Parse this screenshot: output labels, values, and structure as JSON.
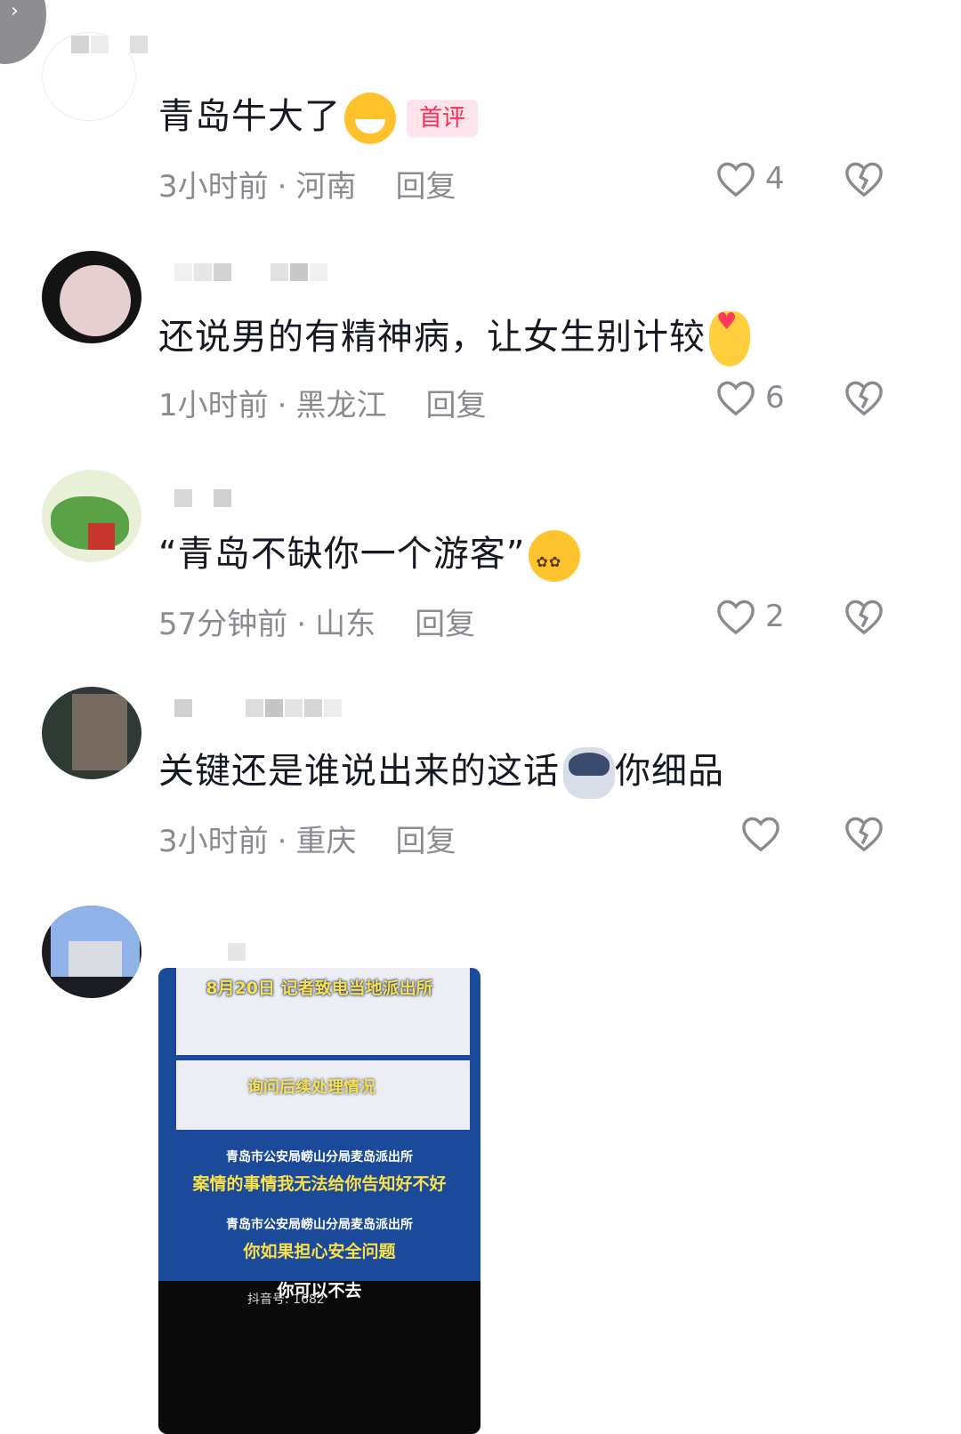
{
  "comments": [
    {
      "text": "青岛牛大了",
      "emoji": "grinning-face-emoji",
      "tag": "首评",
      "time": "3小时前",
      "location": "河南",
      "reply_label": "回复",
      "likes": "4"
    },
    {
      "text": "还说男的有精神病，让女生别计较",
      "emoji": "heart-hand-emoji",
      "time": "1小时前",
      "location": "黑龙江",
      "reply_label": "回复",
      "likes": "6"
    },
    {
      "text": "“青岛不缺你一个游客”",
      "emoji": "dizzy-face-emoji",
      "time": "57分钟前",
      "location": "山东",
      "reply_label": "回复",
      "likes": "2"
    },
    {
      "text_before": "关键还是谁说出来的这话",
      "emoji": "dog-face-emoji",
      "text_after": "你细品",
      "time": "3小时前",
      "location": "重庆",
      "reply_label": "回复",
      "likes": ""
    }
  ],
  "video_card": {
    "header": "8月20日 记者致电当地派出所",
    "subtitle": "询问后续处理情况",
    "source1": "青岛市公安局崂山分局麦岛派出所",
    "quote1": "案情的事情我无法给你告知好不好",
    "source2": "青岛市公安局崂山分局麦岛派出所",
    "quote2": "你如果担心安全问题",
    "final": "你可以不去",
    "watermark": "抖音号: 1682"
  },
  "separator": "·"
}
